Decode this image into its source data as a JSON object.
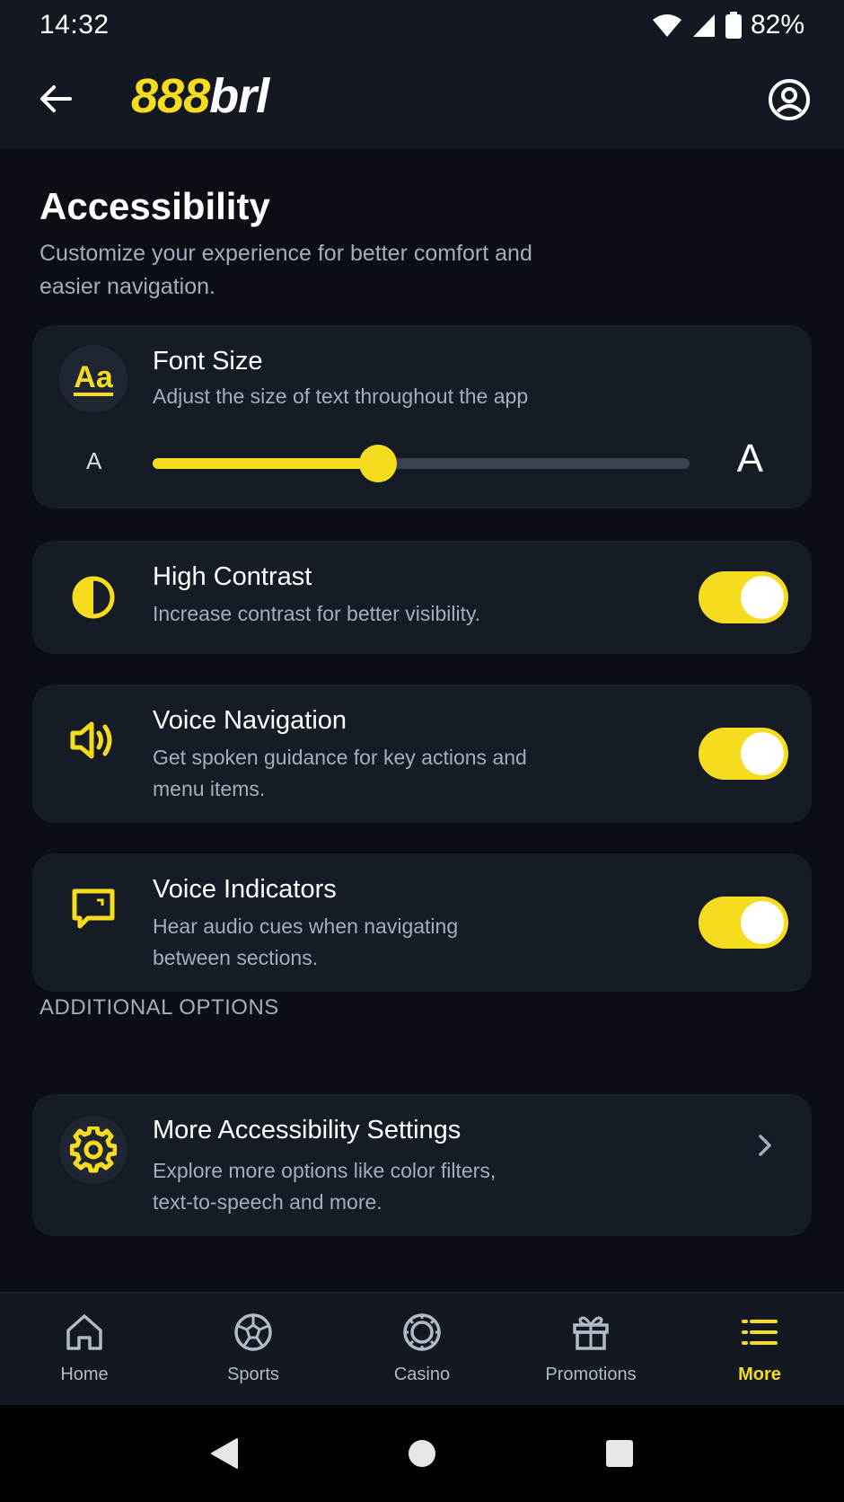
{
  "status_bar": {
    "time": "14:32",
    "battery": "82%"
  },
  "header": {
    "logo_number": "888",
    "logo_text": "brl"
  },
  "page": {
    "title": "Accessibility",
    "subtitle": "Customize your experience for better comfort and easier navigation."
  },
  "font_size": {
    "title": "Font Size",
    "description": "Adjust the size of text throughout the app",
    "small_label": "A",
    "large_label": "A",
    "slider_value": 0.42,
    "icon_glyph": "Aa"
  },
  "settings": [
    {
      "title": "High Contrast",
      "description": "Increase contrast for better visibility.",
      "enabled": true,
      "icon": "contrast-icon"
    },
    {
      "title": "Voice Navigation",
      "description": "Get spoken guidance for key actions and menu items.",
      "enabled": true,
      "icon": "speaker-icon"
    },
    {
      "title": "Voice Indicators",
      "description": "Hear audio cues when navigating between sections.",
      "enabled": true,
      "icon": "chat-bubble-icon"
    }
  ],
  "additional": {
    "section_label": "ADDITIONAL OPTIONS",
    "title": "More Accessibility Settings",
    "description": "Explore more options like color filters, text-to-speech and more.",
    "icon": "gear-icon"
  },
  "bottom_nav": [
    {
      "label": "Home",
      "icon": "home-icon",
      "active": false
    },
    {
      "label": "Sports",
      "icon": "soccer-ball-icon",
      "active": false
    },
    {
      "label": "Casino",
      "icon": "casino-chip-icon",
      "active": false
    },
    {
      "label": "Promotions",
      "icon": "gift-icon",
      "active": false
    },
    {
      "label": "More",
      "icon": "menu-list-icon",
      "active": true
    }
  ],
  "colors": {
    "accent": "#f5dc1f",
    "background": "#0b0f15",
    "card": "#161c26",
    "muted_text": "#a4adbd"
  }
}
